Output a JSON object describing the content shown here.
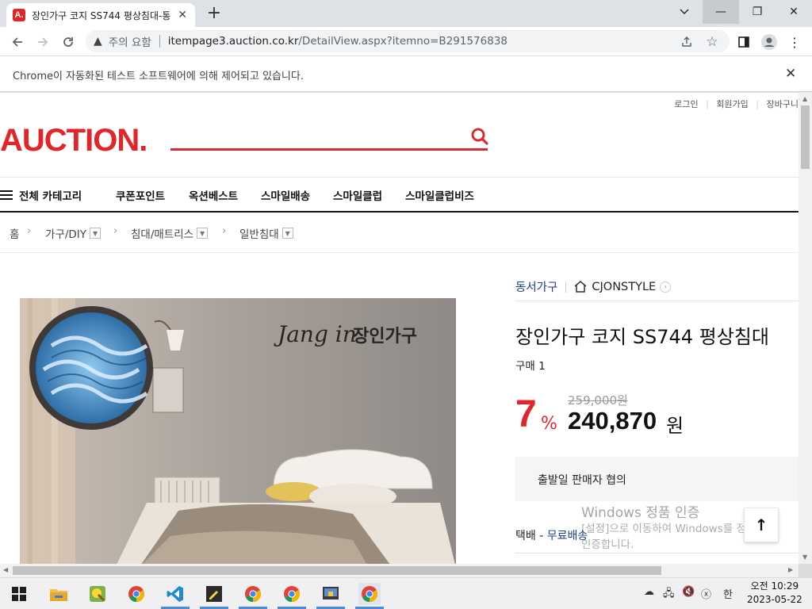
{
  "browser": {
    "tab_favicon": "A.",
    "tab_title": "장인가구 코지 SS744 평상침대-통",
    "tab_close": "✕",
    "new_tab": "+",
    "window_controls": {
      "minimize": "—",
      "restore": "❐",
      "close": "✕"
    },
    "security_label": "주의 요함",
    "url_host": "itempage3.auction.co.kr",
    "url_path": "/DetailView.aspx?itemno=B291576838",
    "infobar_text": "Chrome이 자동화된 테스트 소프트웨어에 의해 제어되고 있습니다.",
    "infobar_close": "✕"
  },
  "header": {
    "util_links": [
      "로그인",
      "회원가입",
      "장바구니"
    ],
    "logo_text": "AUCTION",
    "logo_dot": ".",
    "brand_color": "#e0262b"
  },
  "gnb": {
    "all_category": "전체 카테고리",
    "items": [
      "쿠폰포인트",
      "옥션베스트",
      "스마일배송",
      "스마일클럽",
      "스마일클럽비즈"
    ]
  },
  "breadcrumb": {
    "home": "홈",
    "levels": [
      "가구/DIY",
      "침대/매트리스",
      "일반침대"
    ]
  },
  "product_image": {
    "brand_mark_latin": "Jang in",
    "brand_mark_korean": "장인가구"
  },
  "product": {
    "seller": "동서가구",
    "store": "CJONSTYLE",
    "title": "장인가구 코지 SS744 평상침대",
    "purchase_count": "구매 1",
    "discount": "7",
    "discount_unit": "%",
    "original_price": "259,000원",
    "price": "240,870",
    "price_unit": "원",
    "ship_date": "출발일 판매자 협의",
    "delivery_label": "택배 - ",
    "delivery_value": "무료배송"
  },
  "overlay": {
    "activation_title": "Windows 정품 인증",
    "activation_line1": "[설정]으로 이동하여 Windows를 정품",
    "activation_line2": "인증합니다.",
    "top_button": "↑"
  },
  "taskbar": {
    "time": "오전 10:29",
    "date": "2023-05-22",
    "ime": "한"
  }
}
